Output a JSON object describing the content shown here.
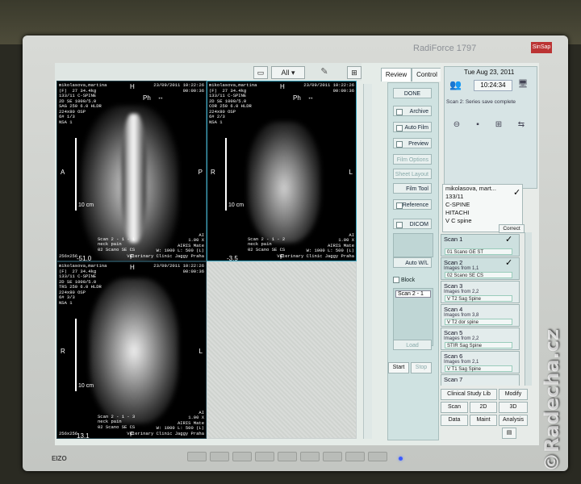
{
  "monitor": {
    "brand": "RadiForce 1797",
    "badge": "SinSap",
    "maker": "EIZO",
    "watermark": "©Radecha.cz"
  },
  "toolbar": {
    "view_mode": "All",
    "view_mode_arrow": "▾"
  },
  "viewports": [
    {
      "info_left": "mikolasova,martina\n(F)  27 34.4kg\n133/11 C-SPINE\n2D SE 1000/5.0\nSAG 250 6.0 HLDR\n224x80 OSP\n6# 1/3\nNSA 1",
      "info_right": "23/09/2011 10:22:26\n00:00:36",
      "top": "H",
      "left": "A",
      "right": "P",
      "bottom": "F",
      "scale": "10 cm",
      "ph": "Ph",
      "bottom_left": "256x256",
      "bottom_num": "-51.0",
      "bottom_center": "Scan 2 - 1 - 1\nneck pain\n02 Scano SE CS",
      "bottom_right": "AI\n1.00 X\nAIRIS Mate\nW: 1000 L: 500 (L)\nVeterinary Clinic Jaggy Praha"
    },
    {
      "info_left": "mikolasova,martina\n(F)  27 34.4kg\n133/11 C-SPINE\n2D SE 1000/5.0\nCOR 250 6.0 HLDR\n224x80 OSP\n6# 2/3\nNSA 1",
      "info_right": "23/09/2011 10:22:26\n00:00:36",
      "top": "H",
      "left": "R",
      "right": "L",
      "bottom": "F",
      "scale": "10 cm",
      "ph": "Ph",
      "bottom_left": "256x256",
      "bottom_num": "-3.5",
      "bottom_center": "Scan 2 - 1 - 2\nneck pain\n02 Scano SE CS",
      "bottom_right": "AI\n1.00 X\nAIRIS Mate\nW: 1000 L: 500 (L)\nVeterinary Clinic Jaggy Praha"
    },
    {
      "info_left": "mikolasova,martina\n(F)  27 34.4kg\n133/11 C-SPINE\n2D SE 1000/5.0\nTRS 250 6.0 HLDR\n224x80 OSP\n6# 3/3\nNSA 1",
      "info_right": "23/09/2011 10:22:26\n00:00:36",
      "top": "H",
      "left": "R",
      "right": "L",
      "bottom": "F",
      "scale": "10 cm",
      "ph": "",
      "bottom_left": "256x256",
      "bottom_num": "13.1",
      "bottom_center": "Scan 2 - 1 - 3\nneck pain\n02 Scano SE CS",
      "bottom_right": "AI\n1.00 X\nAIRIS Mate\nW: 1000 L: 500 (L)\nVeterinary Clinic Jaggy Praha"
    }
  ],
  "tabs": {
    "review": "Review",
    "control": "Control"
  },
  "review": {
    "done": "DONE",
    "archive": "Archive",
    "auto_film": "Auto Film",
    "preview": "Preview",
    "film_options": "Film Options",
    "sheet_layout": "Sheet Layout",
    "film_tool": "Film Tool",
    "reference": "Reference",
    "dicom": "DICOM",
    "auto_wl": "Auto W/L",
    "block": "Block",
    "block_item": "Scan 2 - 1",
    "load": "Load",
    "start": "Start",
    "stop": "Stop"
  },
  "right_panel": {
    "date": "Tue Aug 23, 2011",
    "time": "10:24:34",
    "status": "Scan 2: Series save complete",
    "patient": {
      "name": "mikolasova, mart...",
      "id": "133/11",
      "region": "C-SPINE",
      "maker": "HITACHI",
      "note": "V C spine"
    },
    "correct": "Correct",
    "series": [
      {
        "title": "Scan 1",
        "sub": "",
        "protocol": "01 Scano GE ST",
        "checked": true
      },
      {
        "title": "Scan 2",
        "sub": "Images from 1,1",
        "protocol": "02 Scano SE CS",
        "checked": true
      },
      {
        "title": "Scan 3",
        "sub": "Images from 2,2",
        "protocol": "V T2 Sag Spine",
        "checked": false
      },
      {
        "title": "Scan 4",
        "sub": "Images from 3,8",
        "protocol": "V T2 dor spine",
        "checked": false
      },
      {
        "title": "Scan 5",
        "sub": "Images from 2,2",
        "protocol": "STIR Sag Spine",
        "checked": false
      },
      {
        "title": "Scan 6",
        "sub": "Images from 2,1",
        "protocol": "V T1 Sag Spine",
        "checked": false
      },
      {
        "title": "Scan 7",
        "sub": "",
        "protocol": "",
        "checked": false
      }
    ],
    "buttons": {
      "clinical": "Clinical Study Lib",
      "modify": "Modify",
      "scan": "Scan",
      "two_d": "2D",
      "three_d": "3D",
      "data": "Data",
      "maint": "Maint",
      "analysis": "Analysis"
    }
  }
}
